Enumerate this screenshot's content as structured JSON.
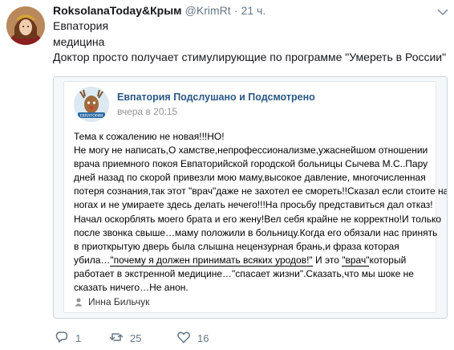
{
  "tweet": {
    "author_name": "RoksolanaToday&Крым",
    "author_handle": "@KrimRt",
    "separator": "·",
    "time": "21 ч.",
    "text_lines": [
      "Евпатория",
      "медицина",
      "Доктор просто получает стимулирующие по программе \"Умереть в России\""
    ]
  },
  "attachment": {
    "group_name": "Евпатория Подслушано и Подсмотрено",
    "post_time": "вчера в 20:15",
    "avatar_text": "ЕВПАТОРИЯ",
    "body_lines": [
      "Тема к сожалению не новая!!!НО!",
      "Не могу не написать,О хамстве,непрофессионализме,ужаснейшом отношении",
      "врача приемного покоя Евпаторийской городской больницы Сычева М.С..Пару",
      "дней назад по скорой привезли мою маму,высокое давление, многочисленная",
      "потеря сознания,так этот \"врач\"даже не захотел ее смореть!!Сказал если стоите на",
      "ногах и не умираете здесь делать нечего!!!На просьбу представиться дал отказ!",
      "Начал оскорблять моего брата и его жену!Вел себя крайне не корректно!И только",
      "после звонка свыше…маму положили в больницу.Когда его обязали нас принять",
      "в приоткрытую дверь была слышна нецензурная брань,и фраза которая"
    ],
    "line10_a": "убила…",
    "line10_b": "\"почему я должен принимать всяких уродов!\"",
    "line10_c": " И это ",
    "line10_d": "\"врач\"",
    "line10_e": "который",
    "line11": "работает в экстренной медицине…\"спасает жизни\".Сказать,что мы шоке не",
    "line12": "сказать ничего…Не анон.",
    "signature": "Инна Бильчук"
  },
  "actions": {
    "reply_count": "1",
    "retweet_count": "25",
    "like_count": "16"
  },
  "colors": {
    "link": "#2a5885",
    "secondary": "#657786",
    "border": "#ccd6dd"
  },
  "icons": [
    "chevron-down-icon",
    "reply-icon",
    "retweet-icon",
    "like-icon",
    "person-icon"
  ]
}
